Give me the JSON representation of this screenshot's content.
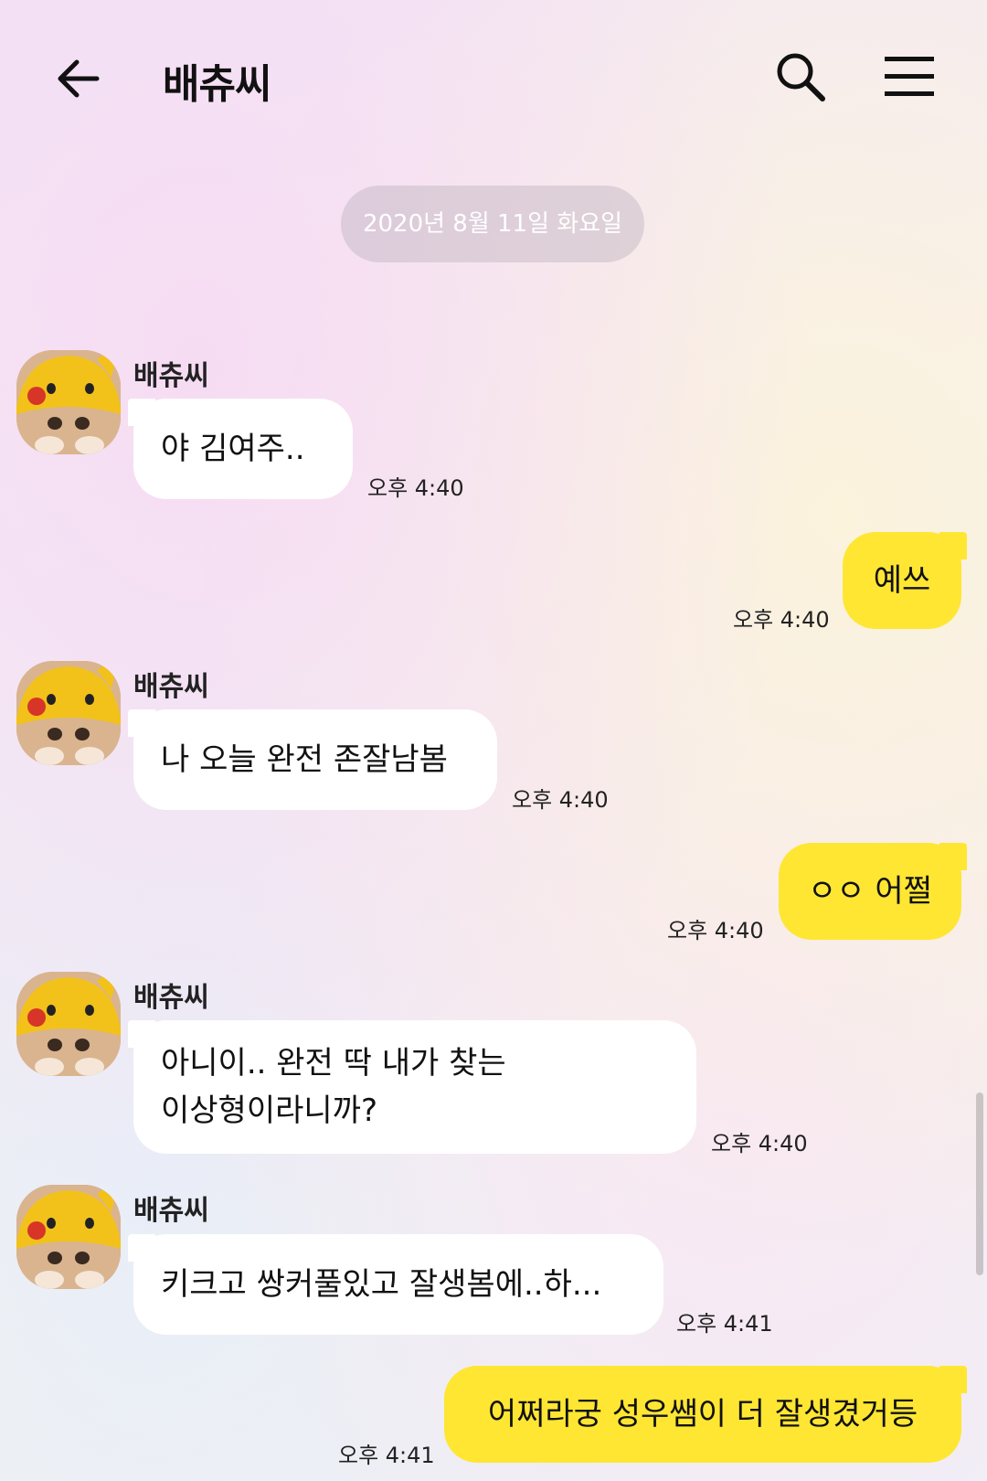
{
  "header": {
    "title": "배츄씨",
    "back_icon": "arrow-left-icon",
    "search_icon": "search-icon",
    "menu_icon": "hamburger-menu-icon"
  },
  "date_divider": "2020년 8월 11일 화요일",
  "messages": [
    {
      "direction": "incoming",
      "sender": "배츄씨",
      "text": "야 김여주..",
      "time": "오후 4:40"
    },
    {
      "direction": "outgoing",
      "text": "예쓰",
      "time": "오후 4:40"
    },
    {
      "direction": "incoming",
      "sender": "배츄씨",
      "text": "나 오늘 완전 존잘남봄",
      "time": "오후 4:40"
    },
    {
      "direction": "outgoing",
      "text": "ㅇㅇ 어쩔",
      "time": "오후 4:40"
    },
    {
      "direction": "incoming",
      "sender": "배츄씨",
      "text_lines": [
        "아니이.. 완전 딱 내가 찾는",
        "이상형이라니까?"
      ],
      "time": "오후 4:40"
    },
    {
      "direction": "incoming",
      "sender": "배츄씨",
      "text": "키크고 쌍커풀있고 잘생봄에..하...",
      "time": "오후 4:41"
    },
    {
      "direction": "outgoing",
      "text": "어쩌라궁 성우쌤이 더 잘생겼거등",
      "time": "오후 4:41"
    }
  ],
  "colors": {
    "outgoing_bubble": "#fee633",
    "incoming_bubble": "#ffffff",
    "date_pill": "#c8bcc8"
  }
}
